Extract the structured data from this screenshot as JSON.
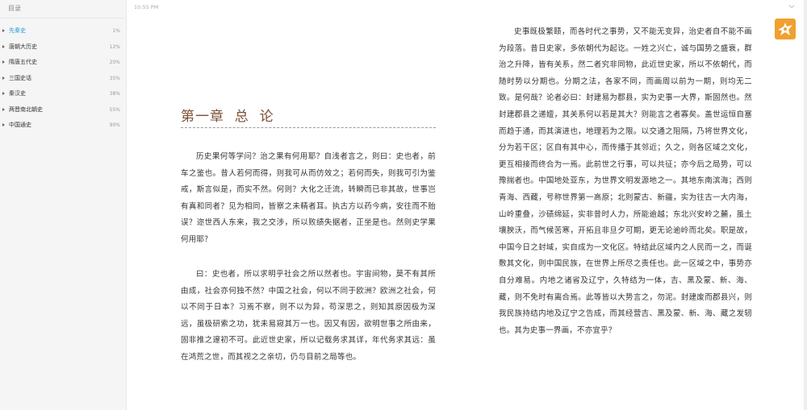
{
  "sidebar": {
    "header": "目录",
    "items": [
      {
        "label": "先秦史",
        "percent": "1%",
        "active": true
      },
      {
        "label": "唐朝大历史",
        "percent": "12%"
      },
      {
        "label": "隋唐五代史",
        "percent": "20%"
      },
      {
        "label": "三国史话",
        "percent": "35%"
      },
      {
        "label": "秦汉史",
        "percent": "38%"
      },
      {
        "label": "两晋南北朝史",
        "percent": "55%"
      },
      {
        "label": "中国通史",
        "percent": "90%"
      }
    ]
  },
  "status": {
    "clock": "10:55 PM"
  },
  "icons": {
    "scroll_down": "chevron-down-icon",
    "logo": "bird-logo-icon",
    "toc_arrow": "triangle-right-icon"
  },
  "colors": {
    "accent_active": "#2d9ad6",
    "chapter_title": "#7b5134",
    "logo": "#f0a030"
  },
  "left_page": {
    "chapter_title": "第一章  总  论",
    "paragraphs": [
      "历史果何等学问？治之果有何用耶？自浅者言之，则曰：史也者，前车之鉴也。昔人若何而得，则我可从而仿效之；若何而失，则我可引为鉴戒，斯言似是，而实不然。何则？大化之迁流，转瞬而已非其故，世事岂有真和同者？见为相同，皆察之未精者耳。执古方以药今病，安往而不贻误？迩世西人东来，我之交涉，所以败绩失据者，正坐是也。然则史学果何用耶？",
      "曰：史也者，所以求明乎社会之所以然者也。宇宙间物，莫不有其所由成，社会亦何独不然？中国之社会，何以不同于欧洲？欧洲之社会，何以不同于日本？习焉不察，则不以为异，苟深思之，则知其原因极为深远，虽极研索之功，犹未易窥其万一也。因又有因，欲明世事之所由来，固非推之邃初不可。此近世史家，所以记载务求其详，年代务求其远：虽在鸿荒之世，而其视之之亲切，仍与目前之局等也。"
    ]
  },
  "right_page": {
    "paragraph": "史事既极繁赜，而各时代之事势，又不能无变异，治史者自不能不画为段落。昔日史家，多依朝代为起讫。一姓之兴亡，诚与国势之盛衰，群治之升降，皆有关系，然二者究非同物，此近世史家，所以不依朝代，而随时势以分期也。分期之法，各家不同，而画周以前为一期，则均无二致。是何哉？论者必曰：封建易为郡县，实为史事一大界，斯固然也。然封建郡县之递嬗，其关系何以若是其大？则能言之者寡矣。盖世运恒自塞而趋于通，而其演进也，地理若为之限。以交通之阻隔，乃将世界文化，分为若干区；区自有其中心，而传播于其邻近；久之，则各区域之文化，更互相接而终合为一焉。此前世之行事，可以共征；亦今后之局势，可以豫揣者也。中国地处亚东，为世界文明发源地之一。其地东南滨海；西则青海、西藏，号称世界第一高原；北则蒙古、新疆，实为往古一大内海，山岭重叠，沙碛绵延，实非昔时人力，所能逾越；东北兴安岭之麓，虽土壤腴沃，而气候苦寒，开拓且非旦夕可期，更无论逾岭而北矣。职是故，中国今日之封域，实自成为一文化区。特结此区域内之人民而一之，而诞敷其文化，则中国民族，在世界上所尽之责任也。此一区域之中，事势亦自分难易。内地之诸省及辽宁，久特结为一体，吉、黑及蒙、新、海、藏，则不免时有离合焉。此等皆以大势言之，勿泥。封建废而郡县兴，则我民族持结内地及辽宁之告成，而其经营吉、黑及蒙、新、海、藏之发轫也。其为史事一界画，不亦宜乎？"
  }
}
